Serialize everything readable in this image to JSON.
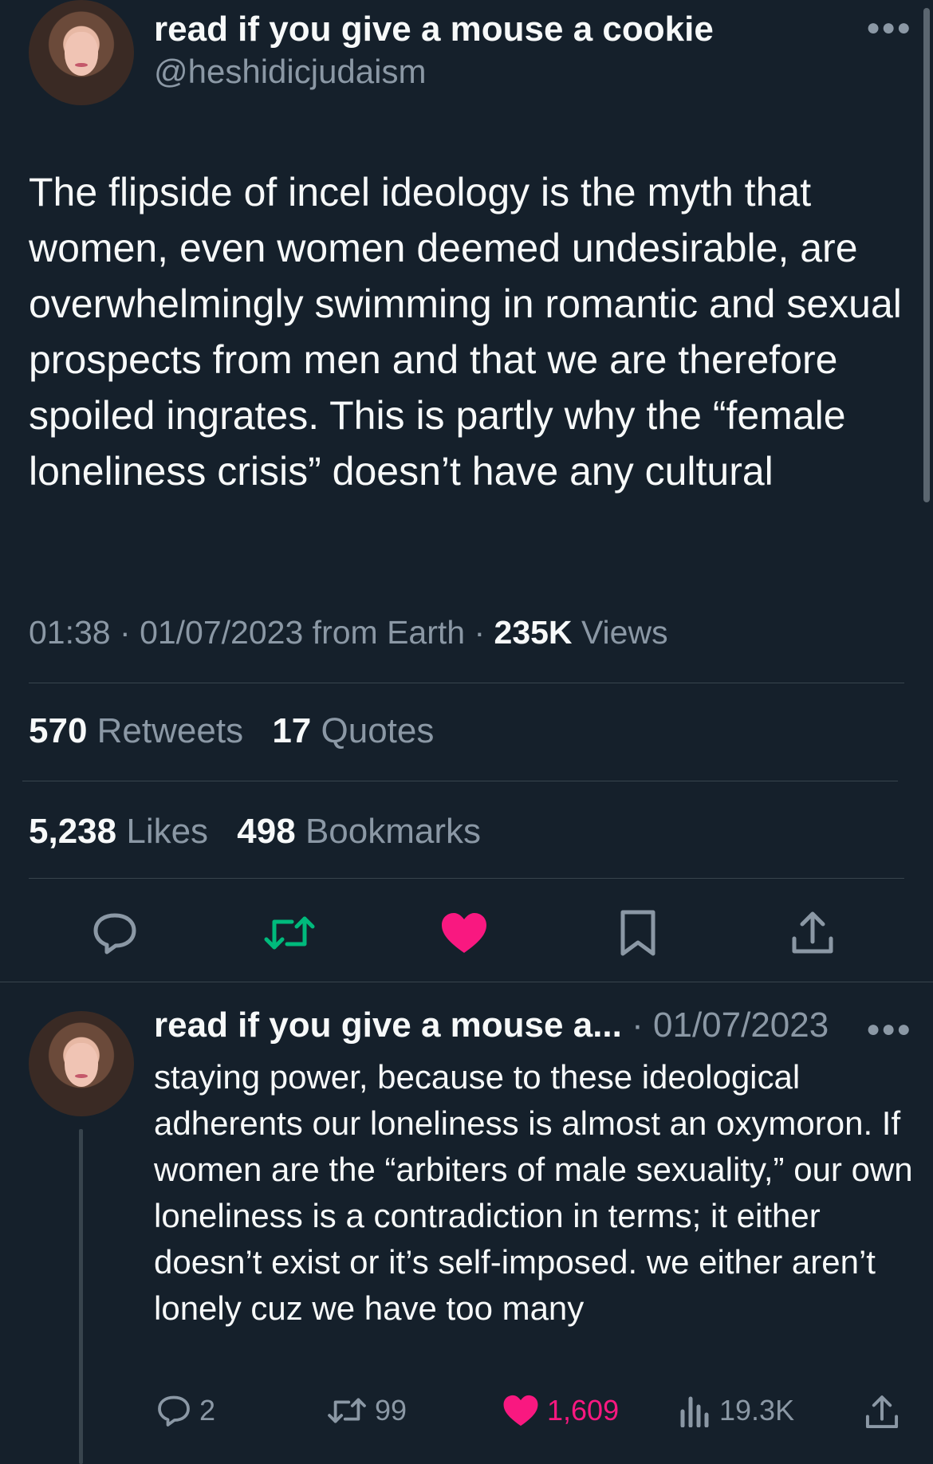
{
  "tweet": {
    "display_name": "read if you give a mouse a cookie",
    "handle": "@heshidicjudaism",
    "text": "The flipside of incel ideology is the myth that women, even women deemed undesirable, are overwhelmingly swimming in romantic and sexual prospects from men and that we are therefore spoiled ingrates. This is partly why the “female loneliness crisis” doesn’t have any cultural",
    "time": "01:38",
    "date": "01/07/2023",
    "source": "from Earth",
    "views_count": "235K",
    "views_label": "Views",
    "retweets_count": "570",
    "retweets_label": "Retweets",
    "quotes_count": "17",
    "quotes_label": "Quotes",
    "likes_count": "5,238",
    "likes_label": "Likes",
    "bookmarks_count": "498",
    "bookmarks_label": "Bookmarks"
  },
  "reply": {
    "display_name": "read if you give a mouse a...",
    "date": "01/07/2023",
    "text": "staying power, because to these ideological adherents our loneliness is almost an oxymoron. If women are the “arbiters of male sexuality,” our own loneliness is a contradiction in terms; it either doesn’t exist or it’s self-imposed. we either aren’t lonely cuz we have too many",
    "replies": "2",
    "retweets": "99",
    "likes": "1,609",
    "views": "19.3K"
  },
  "colors": {
    "background": "#15202b",
    "text": "#f7f9f9",
    "muted": "#8b98a5",
    "retweet_green": "#00ba7c",
    "like_pink": "#f91880",
    "divider": "#38444d"
  },
  "icons": [
    "more-icon",
    "reply-icon",
    "retweet-icon",
    "like-icon",
    "bookmark-icon",
    "share-icon",
    "views-icon"
  ]
}
